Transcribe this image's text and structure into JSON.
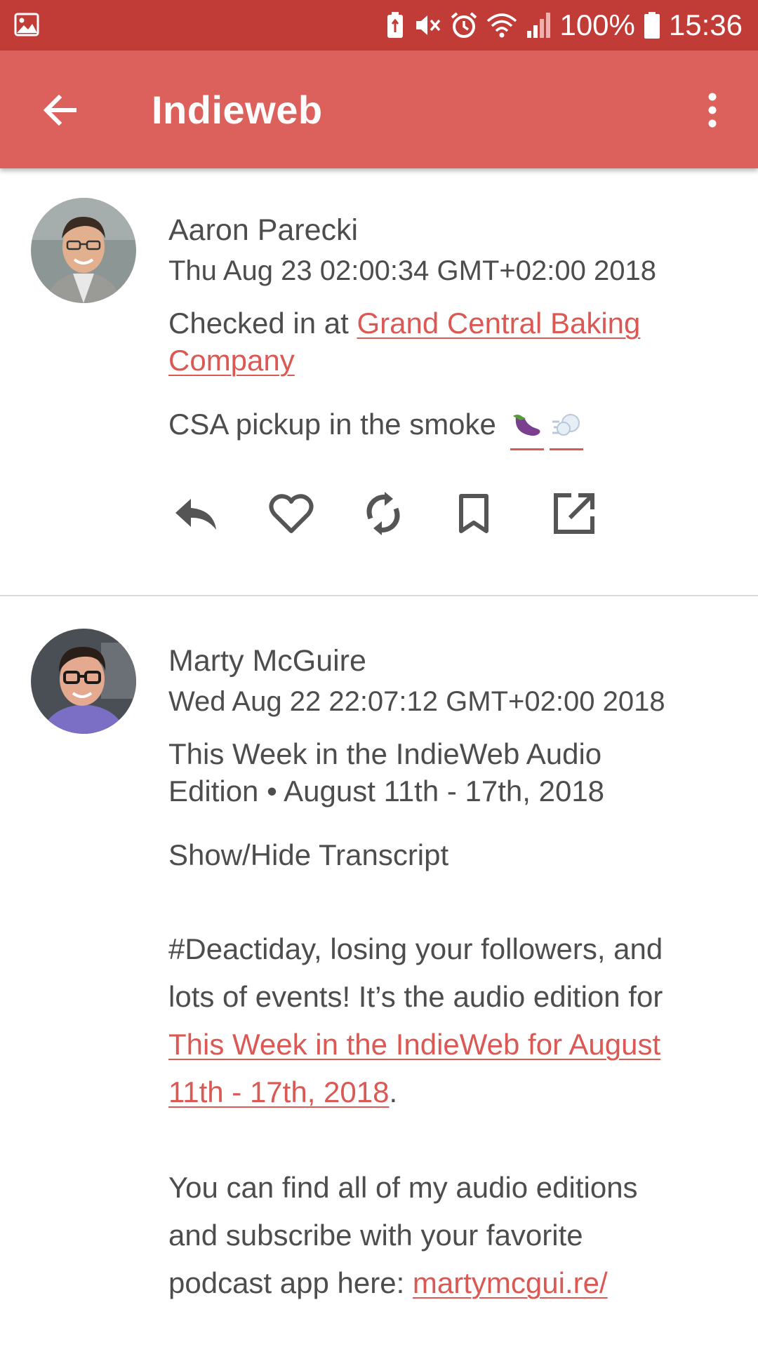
{
  "status_bar": {
    "battery": "100%",
    "time": "15:36"
  },
  "app_bar": {
    "title": "Indieweb"
  },
  "posts": [
    {
      "author": "Aaron Parecki",
      "date": "Thu Aug 23 02:00:34 GMT+02:00 2018",
      "checkin_prefix": "Checked in at ",
      "checkin_link_line1": "Grand Central Baking",
      "checkin_link_line2": "Company",
      "note": "CSA pickup in the smoke",
      "emoji_1": "eggplant-emoji",
      "emoji_2": "dash-emoji"
    },
    {
      "author": "Marty McGuire",
      "date": "Wed Aug 22 22:07:12 GMT+02:00 2018",
      "title_line1": "This Week in the IndieWeb Audio",
      "title_line2": "Edition • August 11th - 17th, 2018",
      "toggle": "Show/Hide Transcript",
      "body1_line1": "#Deactiday, losing your followers, and",
      "body1_line2": "lots of events! It’s the audio edition for",
      "body1_link_line1": "This Week in the IndieWeb for August",
      "body1_link_line2": "11th - 17th, 2018",
      "body1_end": ".",
      "body2_line1": "You can find all of my audio editions",
      "body2_line2": "and subscribe with your favorite",
      "body2_prefix": "podcast app here: ",
      "body2_link": "martymcgui.re/"
    }
  ],
  "actions": [
    "reply-icon",
    "like-icon",
    "repost-icon",
    "bookmark-icon",
    "open-external-icon"
  ],
  "colors": {
    "status_bar": "#c13b37",
    "app_bar": "#dc605c",
    "link": "#db5954",
    "icon": "#555555"
  }
}
